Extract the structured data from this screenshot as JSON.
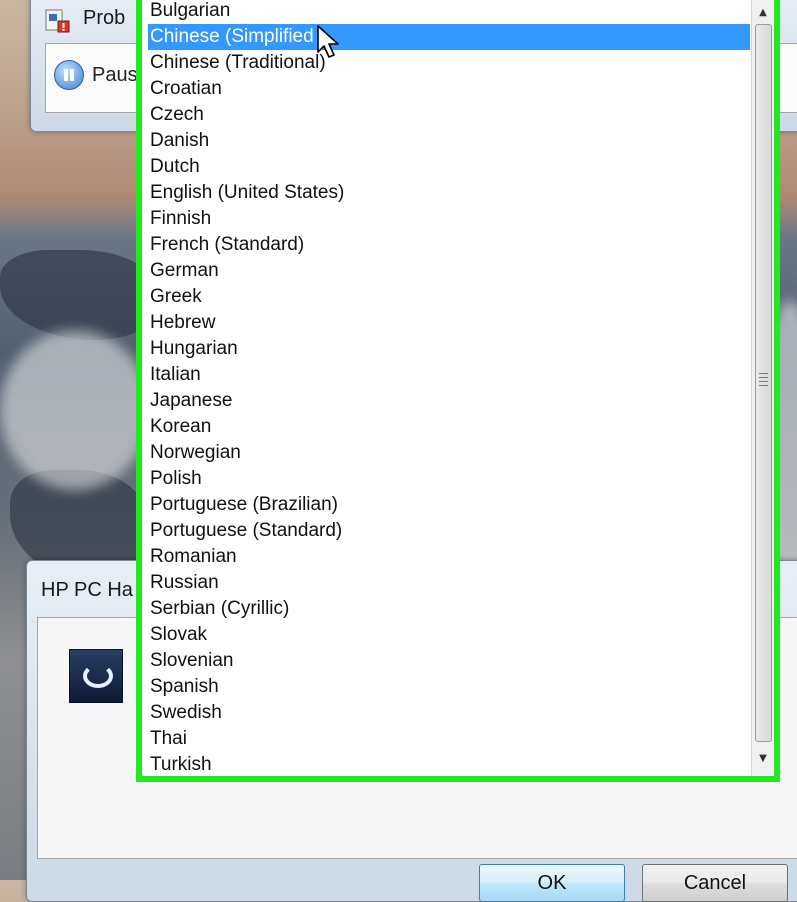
{
  "problem_window": {
    "title": "Prob",
    "pause_label": "Paus"
  },
  "hp_window": {
    "title": "HP PC Ha",
    "ok_label": "OK",
    "cancel_label": "Cancel"
  },
  "language_list": {
    "selected_index": 1,
    "items": [
      "Bulgarian",
      "Chinese (Simplified",
      "Chinese (Traditional)",
      "Croatian",
      "Czech",
      "Danish",
      "Dutch",
      "English (United States)",
      "Finnish",
      "French (Standard)",
      "German",
      "Greek",
      "Hebrew",
      "Hungarian",
      "Italian",
      "Japanese",
      "Korean",
      "Norwegian",
      "Polish",
      "Portuguese (Brazilian)",
      "Portuguese (Standard)",
      "Romanian",
      "Russian",
      "Serbian (Cyrillic)",
      "Slovak",
      "Slovenian",
      "Spanish",
      "Swedish",
      "Thai",
      "Turkish"
    ]
  },
  "colors": {
    "highlight_border": "#22e822",
    "selection": "#3399ff"
  },
  "icons": {
    "problem_app": "problem-reports-icon",
    "pause": "pause-icon",
    "hp_app": "hp-support-icon",
    "cursor": "mouse-pointer-icon"
  }
}
